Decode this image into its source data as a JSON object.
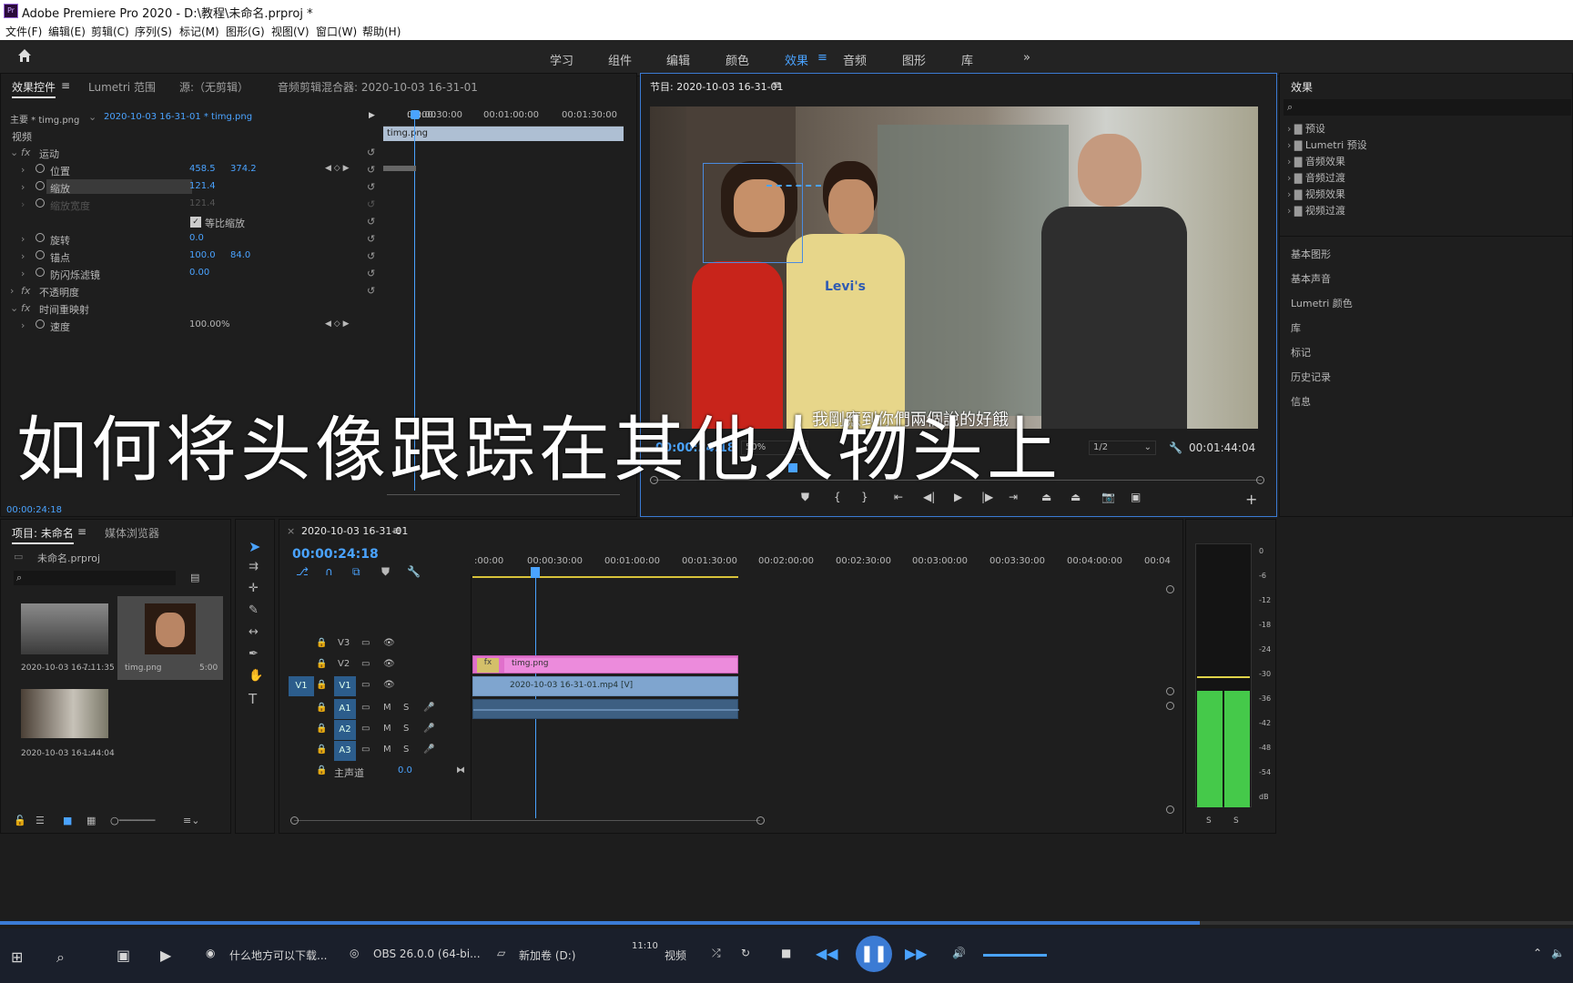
{
  "window": {
    "title": "Adobe Premiere Pro 2020 - D:\\教程\\未命名.prproj *",
    "app_badge": "Pr"
  },
  "menu": [
    "文件(F)",
    "编辑(E)",
    "剪辑(C)",
    "序列(S)",
    "标记(M)",
    "图形(G)",
    "视图(V)",
    "窗口(W)",
    "帮助(H)"
  ],
  "workspaces": [
    "学习",
    "组件",
    "编辑",
    "颜色",
    "效果",
    "音频",
    "图形",
    "库",
    "»"
  ],
  "effect_controls": {
    "tabs": [
      "效果控件",
      "Lumetri 范围",
      "源:（无剪辑）",
      "音频剪辑混合器: 2020-10-03 16-31-01"
    ],
    "source": "主要 * timg.png",
    "sequence": "2020-10-03 16-31-01 * timg.png",
    "ruler": [
      ":00:00",
      "00:00:30:00",
      "00:01:00:00",
      "00:01:30:00"
    ],
    "clip_label": "timg.png",
    "section_video": "视频",
    "motion": "运动",
    "position_label": "位置",
    "position_x": "458.5",
    "position_y": "374.2",
    "scale_label": "缩放",
    "scale_value": "121.4",
    "scale_width_label": "缩放宽度",
    "scale_width_value": "121.4",
    "uniform_label": "等比缩放",
    "rotation_label": "旋转",
    "rotation_value": "0.0",
    "anchor_label": "锚点",
    "anchor_x": "100.0",
    "anchor_y": "84.0",
    "flicker_label": "防闪烁滤镜",
    "flicker_value": "0.00",
    "opacity": "不透明度",
    "time_remap": "时间重映射",
    "speed_label": "速度",
    "speed_value": "100.00%",
    "timecode": "00:00:24:18"
  },
  "program": {
    "title": "节目: 2020-10-03 16-31-01",
    "timecode": "00:00:24:18",
    "zoom": "50%",
    "quality": "1/2",
    "duration": "00:01:44:04",
    "subtitle": "我剛應到你們兩個說的好餓",
    "shirt_text": "Levi's"
  },
  "overlay_title": "如何将头像跟踪在其他人物头上",
  "effects_panel": {
    "title": "效果",
    "folders": [
      "预设",
      "Lumetri 预设",
      "音频效果",
      "音频过渡",
      "视频效果",
      "视频过渡"
    ],
    "sections": [
      "基本图形",
      "基本声音",
      "Lumetri 颜色",
      "库",
      "标记",
      "历史记录",
      "信息"
    ]
  },
  "project": {
    "tabs": [
      "项目: 未命名",
      "媒体浏览器"
    ],
    "file": "未命名.prproj",
    "items": [
      {
        "name": "2020-10-03 16-...",
        "duration": "7:11:35"
      },
      {
        "name": "timg.png",
        "duration": "5:00"
      },
      {
        "name": "2020-10-03 16-...",
        "duration": "1:44:04"
      }
    ]
  },
  "timeline": {
    "tab": "2020-10-03 16-31-01",
    "timecode": "00:00:24:18",
    "ruler": [
      ":00:00",
      "00:00:30:00",
      "00:01:00:00",
      "00:01:30:00",
      "00:02:00:00",
      "00:02:30:00",
      "00:03:00:00",
      "00:03:30:00",
      "00:04:00:00",
      "00:04"
    ],
    "tracks": [
      {
        "id": "V3",
        "src": ""
      },
      {
        "id": "V2",
        "src": ""
      },
      {
        "id": "V1",
        "src": "V1"
      },
      {
        "id": "A1",
        "src": ""
      },
      {
        "id": "A2",
        "src": ""
      },
      {
        "id": "A3",
        "src": ""
      }
    ],
    "master_label": "主声道",
    "master_value": "0.0",
    "clip_v2": "timg.png",
    "clip_v1": "2020-10-03 16-31-01.mp4 [V]"
  },
  "meter": {
    "scale": [
      "0",
      "-6",
      "-12",
      "-18",
      "-24",
      "-30",
      "-36",
      "-42",
      "-48",
      "-54",
      "dB"
    ],
    "solo": [
      "S",
      "S"
    ]
  },
  "taskbar": {
    "items": [
      "什么地方可以下载...",
      "OBS 26.0.0 (64-bi...",
      "新加卷 (D:)",
      "视频"
    ],
    "clock": "11:10"
  }
}
